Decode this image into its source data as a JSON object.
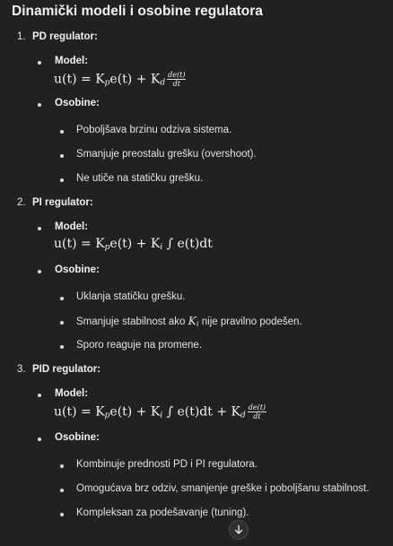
{
  "title": "Dinamički modeli i osobine regulatora",
  "sections": [
    {
      "number": "1.",
      "title": "PD regulator:",
      "model_label": "Model:",
      "model_formula": {
        "lhs": "u(t) = K",
        "p_sub": "p",
        "mid": "e(t) + K",
        "d_sub": "d",
        "frac_num": "de(t)",
        "frac_den": "dt"
      },
      "features_label": "Osobine:",
      "features": [
        "Poboljšava brzinu odziva sistema.",
        "Smanjuje preostalu grešku (overshoot).",
        "Ne utiče na statičku grešku."
      ]
    },
    {
      "number": "2.",
      "title": "PI regulator:",
      "model_label": "Model:",
      "model_formula": {
        "lhs": "u(t) = K",
        "p_sub": "p",
        "mid": "e(t) + K",
        "i_sub": "i",
        "tail": " ∫ e(t)dt"
      },
      "features_label": "Osobine:",
      "features": [
        "Uklanja statičku grešku.",
        {
          "before": "Smanjuje stabilnost ako ",
          "symbol": "K",
          "symbol_sub": "i",
          "after": " nije pravilno podešen."
        },
        "Sporo reaguje na promene."
      ]
    },
    {
      "number": "3.",
      "title": "PID regulator:",
      "model_label": "Model:",
      "model_formula": {
        "lhs": "u(t) = K",
        "p_sub": "p",
        "mid": "e(t) + K",
        "i_sub": "i",
        "tail": " ∫ e(t)dt + K",
        "d_sub": "d",
        "frac_num": "de(t)",
        "frac_den": "dt"
      },
      "features_label": "Osobine:",
      "features": [
        "Kombinuje prednosti PD i PI regulatora.",
        "Omogućava brz odziv, smanjenje greške i poboljšanu stabilnost.",
        "Kompleksan za podešavanje (tuning)."
      ]
    }
  ],
  "scroll_button_icon": "arrow-down-icon"
}
